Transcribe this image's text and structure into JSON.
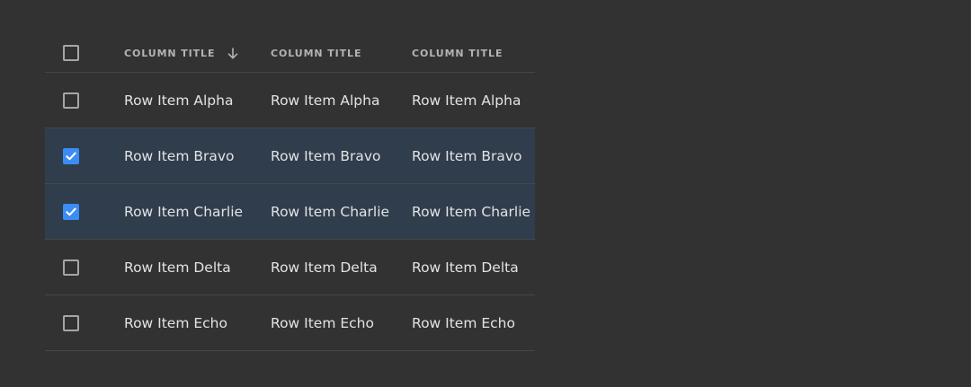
{
  "table": {
    "header": {
      "select_all_checked": false,
      "columns": [
        {
          "title": "COLUMN TITLE",
          "sorted": "descending"
        },
        {
          "title": "COLUMN TITLE"
        },
        {
          "title": "COLUMN TITLE"
        }
      ]
    },
    "rows": [
      {
        "checked": false,
        "cells": [
          "Row Item Alpha",
          "Row Item Alpha",
          "Row Item Alpha"
        ]
      },
      {
        "checked": true,
        "cells": [
          "Row Item Bravo",
          "Row Item Bravo",
          "Row Item Bravo"
        ]
      },
      {
        "checked": true,
        "cells": [
          "Row Item Charlie",
          "Row Item Charlie",
          "Row Item Charlie"
        ]
      },
      {
        "checked": false,
        "cells": [
          "Row Item Delta",
          "Row Item Delta",
          "Row Item Delta"
        ]
      },
      {
        "checked": false,
        "cells": [
          "Row Item Echo",
          "Row Item Echo",
          "Row Item Echo"
        ]
      }
    ]
  },
  "colors": {
    "background": "#323232",
    "selected_row": "#2f3d4c",
    "accent": "#3b8cf5",
    "divider": "#474747"
  },
  "icons": {
    "sort": "arrow-down-icon",
    "check": "checkmark-icon"
  }
}
